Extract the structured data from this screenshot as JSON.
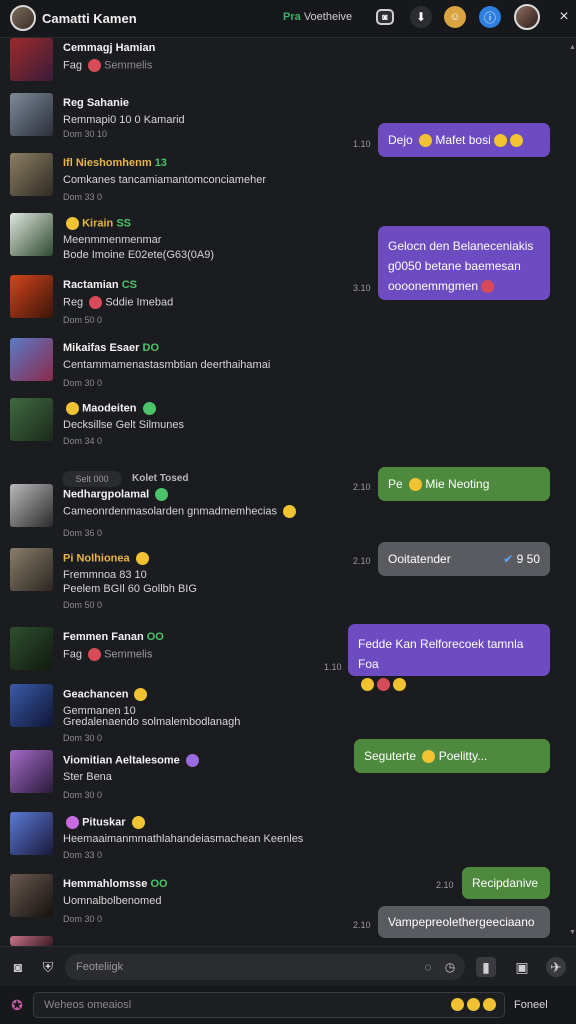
{
  "header": {
    "title": "Camatti Kamen",
    "status_badge": "Pra",
    "status_text": "Voetheive",
    "close_glyph": "×"
  },
  "messages": [
    {
      "name": "Cemmagj Hamian",
      "line2": "Fag",
      "line2b": "Semmelis",
      "tag": ""
    },
    {
      "name": "Reg Sahanie",
      "line2": "Remmapi0 10 0 Kamarid",
      "time": "Dom 30 10"
    },
    {
      "name": "Ifl Nieshomhenm",
      "tag": "13",
      "line2": "Comkanes tancamiamantomconciameher",
      "time": "Dom 33 0"
    },
    {
      "name": "Kirain",
      "tag": "SS",
      "line2": "Meenmmenmenmar",
      "line2b": "Bode  Imoine  E02ete(G63(0A9)",
      "time": ""
    },
    {
      "name": "Ractamian",
      "tag": "CS",
      "line2": "Reg",
      "line2b": "Sddie Imebad",
      "time": "Dom 50 0"
    },
    {
      "name": "Mikaifas Esaer",
      "tag": "DO",
      "line2": "Centammamenastasmbtian deerthaihamai",
      "time": "Dom 30 0"
    },
    {
      "name": "Maodeiten",
      "tag": "",
      "line2": "Decksillse Gelt Silmunes",
      "time": "Dom 34 0"
    },
    {
      "name": "Nedhargpolamal",
      "tag": "",
      "line2": "Cameonrdenmasolarden gnmadmemhecias",
      "time": "Dom 36 0"
    },
    {
      "name": "Pi Nolhionea",
      "tag": "",
      "line2": "Fremmnoa 83 10",
      "line2b": "Peelem BGIl 60 Gollbh BIG",
      "time": "Dom 50 0"
    },
    {
      "name": "Femmen Fanan",
      "tag": "OO",
      "line2": "Fag",
      "line2b": "Semmelis",
      "time": ""
    },
    {
      "name": "Geachancen",
      "tag": "",
      "line2": "Gemmanen 10",
      "line2b": "Gredalenaendo solmalembodlanagh",
      "time": "Dom 30 0"
    },
    {
      "name": "Viomitian Aeltalesome",
      "tag": "",
      "line2": "Ster Bena",
      "time": "Dom 30 0"
    },
    {
      "name": "Pituskar",
      "tag": "",
      "line2": "Heemaaimanmmathlahandeiasmachean Keenles",
      "time": "Dom 33 0"
    },
    {
      "name": "Hemmahlomsse",
      "tag": "OO",
      "line2": "Uomnalbolbenomed",
      "time": "Dom 30 0"
    }
  ],
  "sent": [
    {
      "text": "Dejo",
      "text2": "Mafet bosi",
      "time": "1.10"
    },
    {
      "text": "Gelocn den Belaneceniakis",
      "line2": "g0050 betane baemesan",
      "line3": "oooonemmgmen",
      "time": "3.10"
    },
    {
      "text": "Pe",
      "text2": "Mie Neoting",
      "time": "2.10"
    },
    {
      "text": "Ooitatender",
      "text2": "9 50",
      "time": "2.10"
    },
    {
      "text": "Fedde Kan Relforecoek tamnla Foa",
      "line2": "",
      "time": "1.10"
    },
    {
      "text": "Seguterte",
      "text2": "Poelitty...",
      "time": ""
    },
    {
      "text": "Recipdanive",
      "time": "2.10"
    },
    {
      "text": "Vampepreolethergeeciaano",
      "time": "2.10"
    }
  ],
  "divider": {
    "pill": "Selt 000",
    "label": "Kolet Tosed"
  },
  "composer": {
    "placeholder": "Feoteliigk"
  },
  "bottom": {
    "placeholder": "Weheos omeaiosl",
    "send_label": "Foneel"
  },
  "colors": {
    "sent_purple": "#6c4cc0",
    "sent_green": "#4e8a3e",
    "sent_gray": "#5a5b60",
    "online_green": "#3bb06a",
    "accent_blue": "#2f7fe0"
  }
}
